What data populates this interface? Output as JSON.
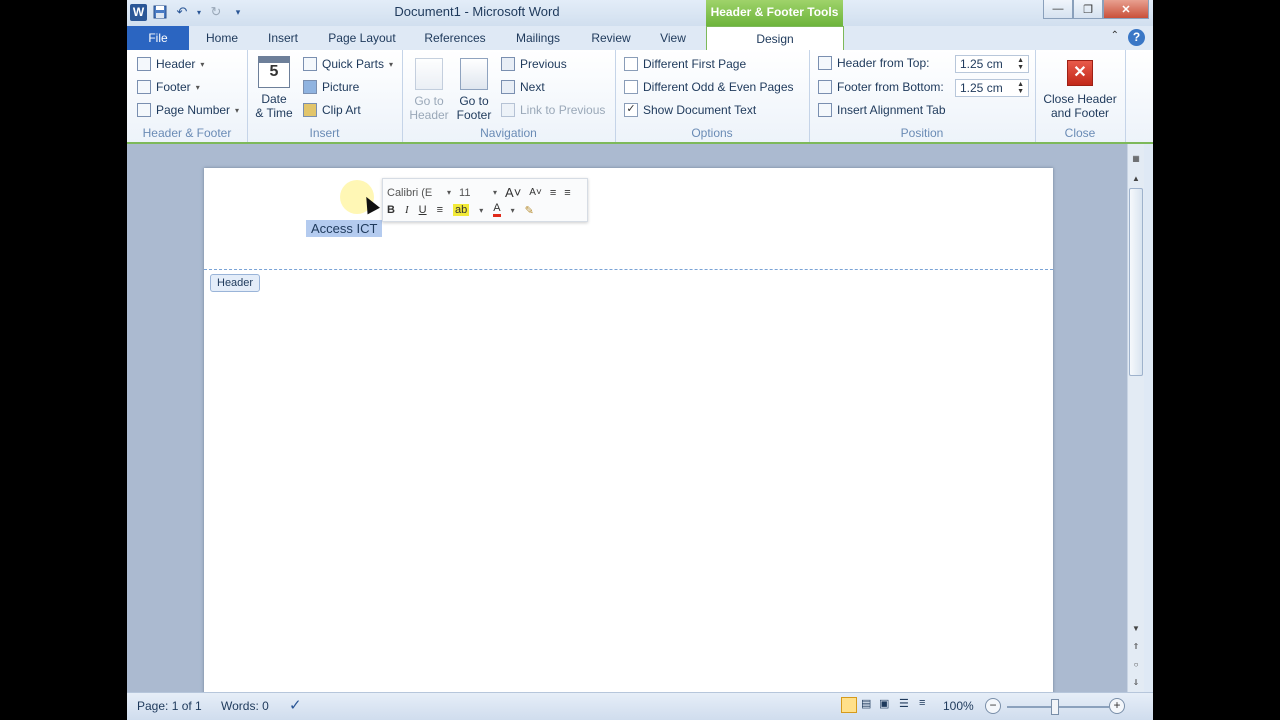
{
  "window": {
    "title": "Document1  -  Microsoft Word",
    "context_tab_title": "Header & Footer Tools",
    "accent_green": "#7db95a",
    "file_tab_color": "#2b65c1"
  },
  "qat": {
    "word_logo": "W",
    "save_icon": "save-icon",
    "undo_icon": "undo-icon",
    "redo_icon": "redo-icon"
  },
  "tabs": [
    {
      "label": "File"
    },
    {
      "label": "Home"
    },
    {
      "label": "Insert"
    },
    {
      "label": "Page Layout"
    },
    {
      "label": "References"
    },
    {
      "label": "Mailings"
    },
    {
      "label": "Review"
    },
    {
      "label": "View"
    },
    {
      "label": "Design",
      "active": true
    }
  ],
  "help_label": "?",
  "ribbon": {
    "header_footer": {
      "label": "Header & Footer",
      "header": "Header",
      "footer": "Footer",
      "page_number": "Page Number"
    },
    "insert": {
      "label": "Insert",
      "date_time_line1": "Date",
      "date_time_line2": "& Time",
      "date_icon_digit": "5",
      "quick_parts": "Quick Parts",
      "picture": "Picture",
      "clip_art": "Clip Art"
    },
    "navigation": {
      "label": "Navigation",
      "go_to_header_line1": "Go to",
      "go_to_header_line2": "Header",
      "go_to_footer_line1": "Go to",
      "go_to_footer_line2": "Footer",
      "previous": "Previous",
      "next": "Next",
      "link_to_previous": "Link to Previous"
    },
    "options": {
      "label": "Options",
      "different_first_page": "Different First Page",
      "different_odd_even": "Different Odd & Even Pages",
      "show_document_text": "Show Document Text",
      "show_document_text_checked": true
    },
    "position": {
      "label": "Position",
      "header_from_top_label": "Header from Top:",
      "header_from_top_value": "1.25 cm",
      "footer_from_bottom_label": "Footer from Bottom:",
      "footer_from_bottom_value": "1.25 cm",
      "insert_alignment_tab": "Insert Alignment Tab"
    },
    "close": {
      "label": "Close",
      "close_line1": "Close Header",
      "close_line2": "and Footer"
    }
  },
  "mini_toolbar": {
    "font": "Calibri (E",
    "size": "11",
    "bold": "B",
    "italic": "I",
    "underline": "U"
  },
  "document": {
    "header_text": "Access ICT",
    "header_tag": "Header"
  },
  "status": {
    "page": "Page: 1 of 1",
    "words": "Words: 0",
    "zoom": "100%"
  }
}
